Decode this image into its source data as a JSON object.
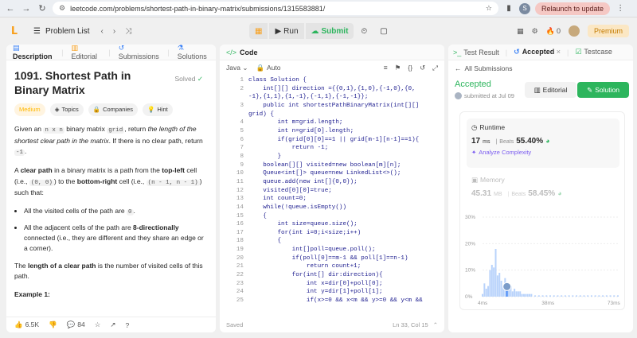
{
  "browser": {
    "url": "leetcode.com/problems/shortest-path-in-binary-matrix/submissions/1315583881/",
    "profile_initial": "S",
    "relaunch_label": "Relaunch to update"
  },
  "appbar": {
    "problem_list": "Problem List",
    "run": "Run",
    "submit": "Submit",
    "streak": "0",
    "premium": "Premium"
  },
  "left": {
    "tabs": [
      "Description",
      "Editorial",
      "Submissions",
      "Solutions"
    ],
    "title": "1091. Shortest Path in Binary Matrix",
    "solved": "Solved",
    "tags": [
      "Medium",
      "Topics",
      "Companies",
      "Hint"
    ],
    "desc": {
      "p1a": "Given an ",
      "p1code1": "n x n",
      "p1b": " binary matrix ",
      "p1code2": "grid",
      "p1c": ", return ",
      "p1em": "the length of the shortest clear path in the matrix",
      "p1d": ". If there is no clear path, return ",
      "p1code3": "-1",
      "p1e": ".",
      "p2a": "A ",
      "p2b": "clear path",
      "p2c": " in a binary matrix is a path from the ",
      "p2d": "top-left",
      "p2e": " cell (i.e., ",
      "p2code1": "(0, 0)",
      "p2f": ") to the ",
      "p2g": "bottom-right",
      "p2h": " cell (i.e., ",
      "p2code2": "(n - 1, n - 1)",
      "p2i": ") such that:",
      "li1a": "All the visited cells of the path are ",
      "li1code": "0",
      "li1b": ".",
      "li2a": "All the adjacent cells of the path are ",
      "li2b": "8-directionally",
      "li2c": " connected (i.e., they are different and they share an edge or a corner).",
      "p3a": "The ",
      "p3b": "length of a clear path",
      "p3c": " is the number of visited cells of this path.",
      "example": "Example 1:"
    },
    "footer": {
      "likes": "6.5K",
      "comments": "84"
    }
  },
  "code": {
    "tab": "Code",
    "language": "Java",
    "mode": "Auto",
    "lines": [
      "class Solution {",
      "    int[][] direction ={{0,1},{1,0},{-1,0},{0,",
      "-1},{1,1},{1,-1},{-1,1},{-1,-1}};",
      "    public int shortestPathBinaryMatrix(int[][]",
      "grid) {",
      "        int m=grid.length;",
      "        int n=grid[0].length;",
      "        if(grid[0][0]==1 || grid[m-1][n-1]==1){",
      "            return -1;",
      "        }",
      "    boolean[][] visited=new boolean[m][n];",
      "    Queue<int[]> queue=new LinkedList<>();",
      "    queue.add(new int[]{0,0});",
      "    visited[0][0]=true;",
      "    int count=0;",
      "    while(!queue.isEmpty())",
      "    {",
      "        int size=queue.size();",
      "        for(int i=0;i<size;i++)",
      "        {",
      "            int[]poll=queue.poll();",
      "            if(poll[0]==m-1 && poll[1]==n-1)",
      "                return count+1;",
      "            for(int[] dir:direction){",
      "                int x=dir[0]+poll[0];",
      "                int y=dir[1]+poll[1];",
      "                if(x>=0 && x<m && y>=0 && y<m &&"
    ],
    "line_numbers": [
      "1",
      "2",
      "",
      "3",
      "",
      "4",
      "5",
      "6",
      "7",
      "8",
      "9",
      "10",
      "11",
      "12",
      "13",
      "14",
      "15",
      "16",
      "17",
      "18",
      "19",
      "20",
      "21",
      "22",
      "23",
      "24",
      "25"
    ],
    "saved": "Saved",
    "cursor": "Ln 33, Col 15"
  },
  "right": {
    "tabs": [
      "Test Result",
      "Accepted",
      "Testcase"
    ],
    "back": "All Submissions",
    "status": "Accepted",
    "submitted": "submitted at Jul 09",
    "editorial": "Editorial",
    "solution": "Solution",
    "runtime_label": "Runtime",
    "runtime_value": "17",
    "runtime_unit": "ms",
    "beats_label": "Beats",
    "runtime_beats": "55.40%",
    "analyze": "Analyze Complexity",
    "memory_label": "Memory",
    "memory_value": "45.31",
    "memory_unit": "MB",
    "memory_beats": "58.45%"
  },
  "chart_data": {
    "type": "bar",
    "title": "",
    "xlabel": "",
    "ylabel": "",
    "yticks": [
      "30%",
      "20%",
      "10%",
      "0%"
    ],
    "xticks": [
      "4ms",
      "38ms",
      "73ms"
    ],
    "ylim": [
      0,
      30
    ],
    "x": [
      4,
      5,
      6,
      7,
      8,
      9,
      10,
      11,
      12,
      13,
      14,
      15,
      16,
      17,
      18,
      19,
      20,
      21,
      22,
      23,
      24,
      25,
      26,
      27,
      28,
      29,
      30,
      32,
      34,
      36,
      38,
      40,
      42,
      44,
      46,
      48,
      50,
      52,
      54,
      56,
      58,
      60,
      62,
      64,
      66,
      68,
      70,
      72,
      74,
      76
    ],
    "values": [
      1,
      5,
      3,
      4,
      10,
      12,
      11,
      18,
      8,
      9,
      6,
      4,
      7,
      5,
      3,
      4,
      2,
      3,
      2,
      2,
      2,
      1,
      1,
      1,
      1,
      1,
      1,
      0.5,
      0.5,
      0.5,
      0.5,
      0.5,
      0.5,
      0.5,
      0.5,
      0.5,
      0.5,
      0.5,
      0.5,
      0.5,
      0.5,
      0.5,
      0.5,
      0.5,
      0.5,
      0.5,
      0.5,
      0.5,
      0.5,
      0.5
    ],
    "highlight_x": 17
  }
}
